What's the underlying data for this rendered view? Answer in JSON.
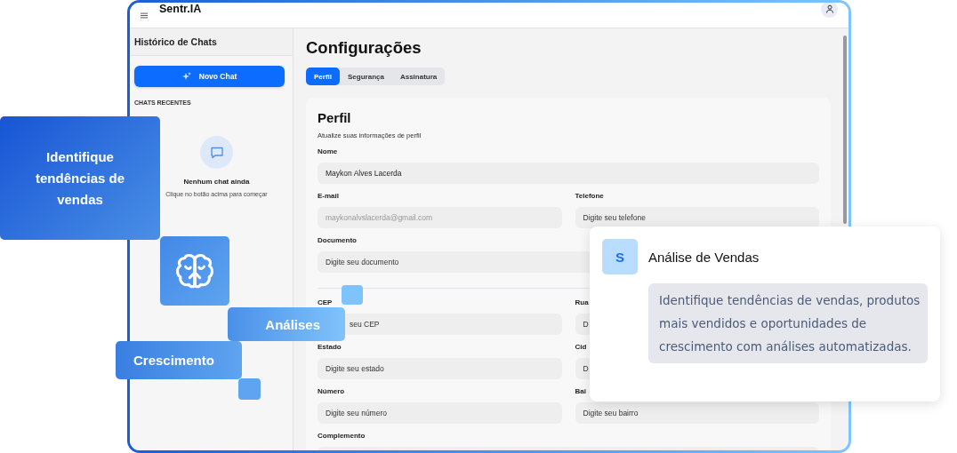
{
  "app": {
    "title": "Sentr.IA"
  },
  "sidebar": {
    "title": "Histórico de Chats",
    "new_chat_button": "Novo Chat",
    "section_label": "CHATS RECENTES",
    "empty_title": "Nenhum chat ainda",
    "empty_hint": "Clique no botão acima para começar"
  },
  "main": {
    "title": "Configurações",
    "tabs": [
      {
        "label": "Perfil",
        "selected": true
      },
      {
        "label": "Segurança",
        "selected": false
      },
      {
        "label": "Assinatura",
        "selected": false
      }
    ],
    "card": {
      "title": "Perfil",
      "subtitle": "Atualize suas informações de perfil",
      "sections": [
        [
          [
            {
              "label": "Nome",
              "value": "Maykon Alves Lacerda"
            }
          ],
          [
            {
              "label": "E-mail",
              "value": "maykonalvslacerda@gmail.com",
              "disabled": true
            },
            {
              "label": "Telefone",
              "placeholder": "Digite seu telefone"
            }
          ],
          [
            {
              "label": "Documento",
              "placeholder": "Digite seu documento"
            }
          ]
        ],
        [
          [
            {
              "label": "CEP",
              "placeholder": "seu CEP"
            },
            {
              "label": "Rua",
              "placeholder": "D"
            }
          ],
          [
            {
              "label": "Estado",
              "placeholder": "Digite seu estado"
            },
            {
              "label": "Cid",
              "placeholder": "D"
            }
          ],
          [
            {
              "label": "Número",
              "placeholder": "Digite seu número"
            },
            {
              "label": "Bai",
              "placeholder": "Digite seu bairro"
            }
          ],
          [
            {
              "label": "Complemento"
            }
          ]
        ]
      ]
    }
  },
  "tiles": [
    {
      "kind": "text",
      "text": "Identifique tendências de vendas"
    },
    {
      "kind": "icon"
    },
    {
      "kind": "text",
      "text": "Análises"
    },
    {
      "kind": "text",
      "text": "Crescimento"
    }
  ],
  "info_card": {
    "avatar": "S",
    "title": "Análise de Vendas",
    "description": "Identifique tendências de vendas, produtos mais vendidos e oportunidades de crescimento com análises automatizadas."
  }
}
